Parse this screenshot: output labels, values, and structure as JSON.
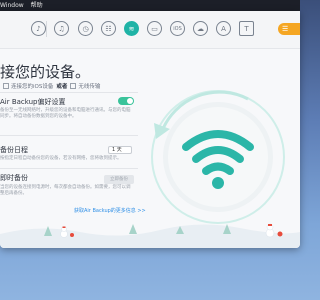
{
  "menubar": {
    "items": [
      "Window",
      "帮助"
    ]
  },
  "toolbar": {
    "icons": [
      "music-icon",
      "history-icon",
      "contacts-icon",
      "wifi-backup-icon",
      "ios-icon",
      "cloud-icon",
      "apps-icon",
      "tshirt-icon"
    ],
    "more_label": "☰"
  },
  "main": {
    "heading": "接您的设备。",
    "subrow": {
      "prefix": "连接您的iOS设备",
      "mid": "或者",
      "suffix": "无线传输"
    },
    "air_backup": {
      "label": "Air Backup偏好设置",
      "desc1": "备份至一无线网络时，升级您的设备和电脑进行通讯。与您的电脑",
      "desc2": "同步。将自动备份数据到您的设备中。",
      "enabled": true
    },
    "schedule": {
      "label": "备份日程",
      "select_value": "1 天",
      "desc": "按指定日程自动备份您的设备，若没有网络，您将收到提示。"
    },
    "trigger": {
      "label": "即时备份",
      "button": "立即备份",
      "desc1": "当您的设备连接到电源时，每次都会自动备份。如需要，您可以调",
      "desc2": "整后再备份。"
    },
    "link_text": "获取Air Backup的更多信息 >>"
  },
  "colors": {
    "accent": "#1fb3a6",
    "wifi": "#2bb6a8",
    "toggle": "#39c39a",
    "link": "#2f8fe6",
    "orange": "#f5a623"
  }
}
